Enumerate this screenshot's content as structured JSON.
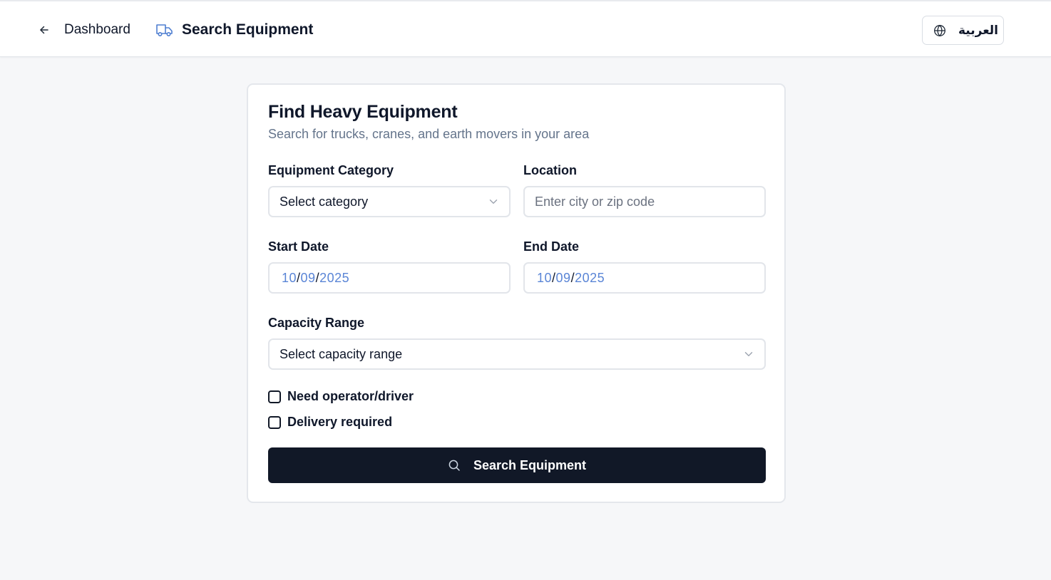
{
  "header": {
    "back_label": "Dashboard",
    "title": "Search Equipment",
    "language_toggle": "العربية"
  },
  "form": {
    "title": "Find Heavy Equipment",
    "subtitle": "Search for trucks, cranes, and earth movers in your area",
    "category": {
      "label": "Equipment Category",
      "value": "Select category"
    },
    "location": {
      "label": "Location",
      "placeholder": "Enter city or zip code"
    },
    "start_date": {
      "label": "Start Date",
      "month": "10",
      "day": "09",
      "year": "2025"
    },
    "end_date": {
      "label": "End Date",
      "month": "10",
      "day": "09",
      "year": "2025"
    },
    "capacity": {
      "label": "Capacity Range",
      "value": "Select capacity range"
    },
    "options": {
      "operator": {
        "label": "Need operator/driver",
        "checked": false
      },
      "delivery": {
        "label": "Delivery required",
        "checked": false
      }
    },
    "submit_label": "Search Equipment"
  },
  "colors": {
    "primary": "#111827",
    "accent": "#5a85d6",
    "background": "#f6f7f9",
    "muted_text": "#64748b"
  },
  "icons": {
    "back": "arrow-left-icon",
    "title": "truck-icon",
    "language": "globe-icon",
    "dropdown": "chevron-down-icon",
    "submit": "search-icon"
  }
}
